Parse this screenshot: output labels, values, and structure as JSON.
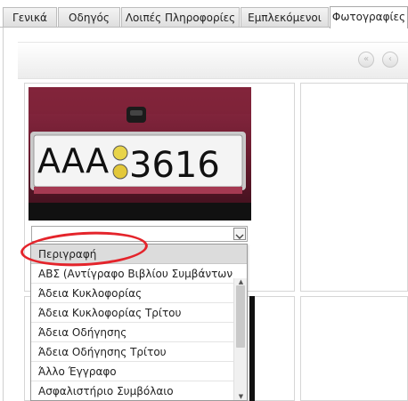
{
  "tabs": [
    {
      "label": "Γενικά",
      "active": false
    },
    {
      "label": "Οδηγός",
      "active": false
    },
    {
      "label": "Λοιπές Πληροφορίες",
      "active": false
    },
    {
      "label": "Εμπλεκόμενοι",
      "active": false
    },
    {
      "label": "Φωτογραφίες",
      "active": true
    }
  ],
  "toolbar": {
    "first_icon": "double-left-arrow-icon",
    "prev_icon": "left-arrow-icon"
  },
  "photo": {
    "plate_text": "AAA",
    "plate_number": "3616"
  },
  "select": {
    "value": "",
    "arrow_icon": "chevron-down-icon"
  },
  "dropdown": {
    "header": "Περιγραφή",
    "options": [
      "ΑΒΣ (Αντίγραφο Βιβλίου Συμβάντων)",
      "Άδεια Κυκλοφορίας",
      "Άδεια Κυκλοφορίας Τρίτου",
      "Άδεια Οδήγησης",
      "Άδεια Οδήγησης Τρίτου",
      "Άλλο Έγγραφο",
      "Ασφαλιστήριο Συμβόλαιο"
    ]
  },
  "colors": {
    "highlight": "#e4242b",
    "plate_border": "#cfcfcf",
    "car_paint": "#7a1f35"
  }
}
